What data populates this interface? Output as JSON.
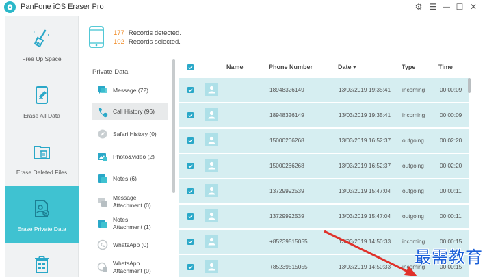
{
  "app": {
    "title": "PanFone iOS Eraser Pro"
  },
  "window_controls": {
    "settings": "⚙",
    "menu": "☰",
    "minimize": "—",
    "maximize": "☐",
    "close": "✕"
  },
  "sidebar": {
    "items": [
      {
        "label": "Free Up Space",
        "icon": "broom-icon"
      },
      {
        "label": "Erase All Data",
        "icon": "erase-phone-icon"
      },
      {
        "label": "Erase Deleted Files",
        "icon": "deleted-files-icon"
      },
      {
        "label": "Erase Private Data",
        "icon": "private-data-icon",
        "active": true
      },
      {
        "label": "",
        "icon": "trash-icon"
      }
    ]
  },
  "summary": {
    "detected_count": "177",
    "detected_label": "Records detected.",
    "selected_count": "102",
    "selected_label": "Records selected."
  },
  "categories": {
    "title": "Private Data",
    "items": [
      {
        "label": "Message (72)"
      },
      {
        "label": "Call History (96)",
        "selected": true
      },
      {
        "label": "Safari History (0)"
      },
      {
        "label": "Photo&video (2)"
      },
      {
        "label": "Notes (6)"
      },
      {
        "label": "Message\nAttachment (0)"
      },
      {
        "label": "Notes\nAttachment (1)"
      },
      {
        "label": "WhatsApp (0)"
      },
      {
        "label": "WhatsApp\nAttachment (0)"
      }
    ]
  },
  "table": {
    "columns": {
      "name": "Name",
      "phone": "Phone Number",
      "date": "Date ▾",
      "type": "Type",
      "time": "Time"
    },
    "rows": [
      {
        "phone": "18948326149",
        "date": "13/03/2019 19:35:41",
        "type": "incoming",
        "time": "00:00:09"
      },
      {
        "phone": "18948326149",
        "date": "13/03/2019 19:35:41",
        "type": "incoming",
        "time": "00:00:09"
      },
      {
        "phone": "15000266268",
        "date": "13/03/2019 16:52:37",
        "type": "outgoing",
        "time": "00:02:20"
      },
      {
        "phone": "15000266268",
        "date": "13/03/2019 16:52:37",
        "type": "outgoing",
        "time": "00:02:20"
      },
      {
        "phone": "13729992539",
        "date": "13/03/2019 15:47:04",
        "type": "outgoing",
        "time": "00:00:11"
      },
      {
        "phone": "13729992539",
        "date": "13/03/2019 15:47:04",
        "type": "outgoing",
        "time": "00:00:11"
      },
      {
        "phone": "+85239515055",
        "date": "13/03/2019 14:50:33",
        "type": "incoming",
        "time": "00:00:15"
      },
      {
        "phone": "+85239515055",
        "date": "13/03/2019 14:50:33",
        "type": "incoming",
        "time": "00:00:15"
      }
    ]
  },
  "watermark": {
    "text": "最需教育"
  },
  "colors": {
    "accent": "#3fc2d1",
    "row_bg": "#d6eef1",
    "count": "#f08a24",
    "checkbox": "#2aa8c8",
    "arrow": "#e0312a"
  }
}
